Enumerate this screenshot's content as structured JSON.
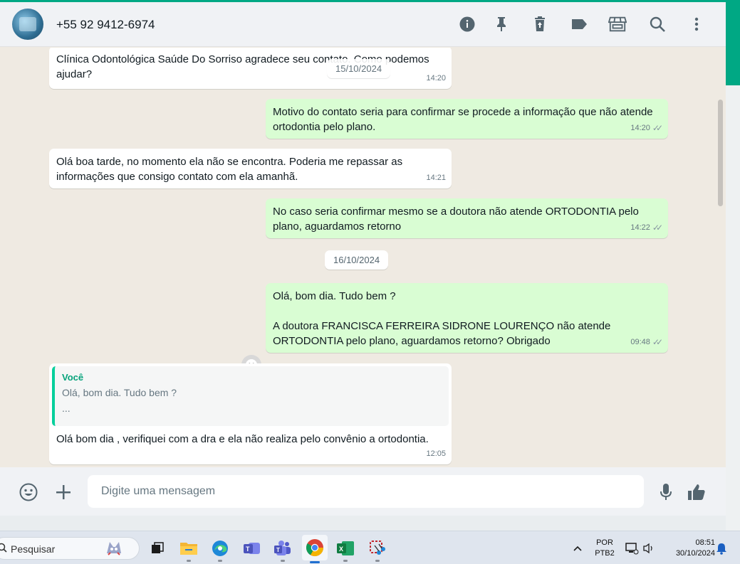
{
  "header": {
    "contact_name": "+55 92 9412-6974",
    "icons": [
      "info-icon",
      "pin-icon",
      "delete-icon",
      "label-icon",
      "store-icon",
      "search-icon",
      "menu-icon"
    ]
  },
  "messages": [
    {
      "id": "m1",
      "dir": "in",
      "text": "Clínica Odontológica Saúde Do Sorriso agradece seu contato. Como podemos ajudar?",
      "time": "14:20"
    },
    {
      "id": "d1",
      "type": "date",
      "text": "15/10/2024"
    },
    {
      "id": "m2",
      "dir": "out",
      "text": "Motivo do contato seria para confirmar se procede a informação que não atende ortodontia pelo plano.",
      "time": "14:20"
    },
    {
      "id": "m3",
      "dir": "in",
      "text": "Olá boa tarde, no momento ela não se encontra. Poderia me repassar as informações que consigo contato com ela amanhã.",
      "time": "14:21"
    },
    {
      "id": "m4",
      "dir": "out",
      "text": "No caso seria confirmar mesmo se a doutora não atende ORTODONTIA pelo plano, aguardamos retorno",
      "time": "14:22"
    },
    {
      "id": "d2",
      "type": "date",
      "text": "16/10/2024"
    },
    {
      "id": "m5",
      "dir": "out",
      "line1": "Olá, bom dia. Tudo bem ?",
      "line2": "A doutora FRANCISCA FERREIRA SIDRONE LOURENÇO não atende ORTODONTIA pelo plano, aguardamos retorno? Obrigado",
      "time": "09:48"
    },
    {
      "id": "m6",
      "dir": "in",
      "quote_author": "Você",
      "quote_line1": "Olá, bom dia. Tudo bem ?",
      "quote_line2": "...",
      "text": "Olá bom dia , verifiquei com a dra e ela não realiza pelo convênio a ortodontia.",
      "time": "12:05"
    }
  ],
  "footer": {
    "placeholder": "Digite uma mensagem"
  },
  "taskbar": {
    "search_label": "Pesquisar",
    "lang_line1": "POR",
    "lang_line2": "PTB2",
    "clock_time": "08:51",
    "clock_date": "30/10/2024"
  },
  "colors": {
    "accent": "#00a884",
    "outgoing_bubble": "#d9fdd3",
    "incoming_bubble": "#ffffff",
    "chat_background": "#efeae2"
  }
}
